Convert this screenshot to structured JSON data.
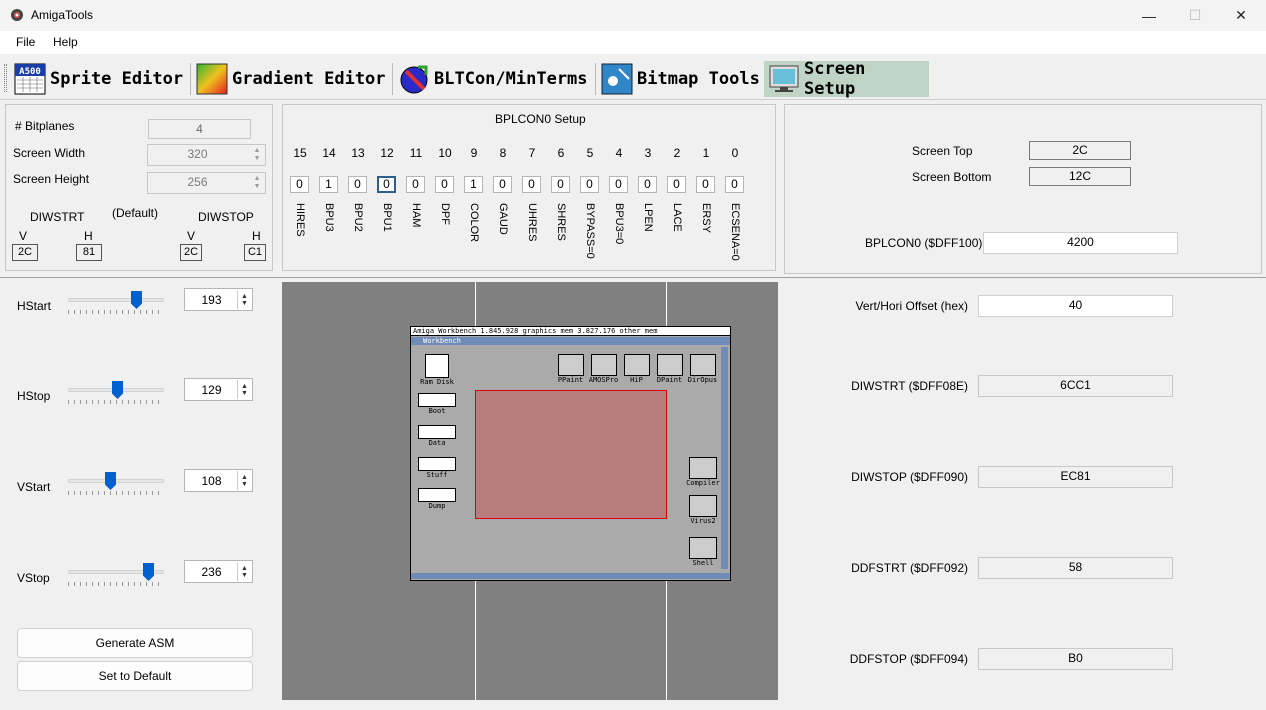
{
  "window": {
    "title": "AmigaTools",
    "minimize": "—",
    "maximize": "☐",
    "close": "✕"
  },
  "menu": [
    "File",
    "Help"
  ],
  "tabs": [
    {
      "label": "Sprite Editor",
      "icon": "sprite-icon"
    },
    {
      "label": "Gradient Editor",
      "icon": "gradient-icon"
    },
    {
      "label": "BLTCon/MinTerms",
      "icon": "blitter-icon"
    },
    {
      "label": "Bitmap Tools",
      "icon": "bitmap-icon"
    },
    {
      "label": "Screen Setup",
      "icon": "monitor-icon",
      "active": true
    }
  ],
  "sprite_icon_text": "A500",
  "screen": {
    "bitplanes_label": "# Bitplanes",
    "bitplanes": "4",
    "width_label": "Screen Width",
    "width": "320",
    "height_label": "Screen Height",
    "height": "256",
    "diwstrt_label": "DIWSTRT",
    "default_label": "(Default)",
    "diwstop_label": "DIWSTOP",
    "v_label": "V",
    "h_label": "H",
    "diwstrt_v": "2C",
    "diwstrt_h": "81",
    "diwstop_v": "2C",
    "diwstop_h": "C1"
  },
  "bplcon0": {
    "title": "BPLCON0 Setup",
    "bits": [
      "15",
      "14",
      "13",
      "12",
      "11",
      "10",
      "9",
      "8",
      "7",
      "6",
      "5",
      "4",
      "3",
      "2",
      "1",
      "0"
    ],
    "values": [
      "0",
      "1",
      "0",
      "0",
      "0",
      "0",
      "1",
      "0",
      "0",
      "0",
      "0",
      "0",
      "0",
      "0",
      "0",
      "0"
    ],
    "names": [
      "HIRES",
      "BPU3",
      "BPU2",
      "BPU1",
      "HAM",
      "DPF",
      "COLOR",
      "GAUD",
      "UHRES",
      "SHRES",
      "BYPASS=0",
      "BPU3=0",
      "LPEN",
      "LACE",
      "ERSY",
      "ECSENA=0"
    ]
  },
  "right_top": {
    "top_label": "Screen Top",
    "top_value": "2C",
    "bottom_label": "Screen Bottom",
    "bottom_value": "12C",
    "bplcon0_label": "BPLCON0 ($DFF100)",
    "bplcon0_value": "4200"
  },
  "sliders": [
    {
      "label": "HStart",
      "value": "193",
      "level": 0.74
    },
    {
      "label": "HStop",
      "value": "129",
      "level": 0.52
    },
    {
      "label": "VStart",
      "value": "108",
      "level": 0.44
    },
    {
      "label": "VStop",
      "value": "236",
      "level": 0.88
    }
  ],
  "buttons": {
    "generate": "Generate ASM",
    "reset": "Set to Default"
  },
  "registers": [
    {
      "label": "Vert/Hori Offset (hex)",
      "value": "40"
    },
    {
      "label": "DIWSTRT ($DFF08E)",
      "value": "6CC1"
    },
    {
      "label": "DIWSTOP ($DFF090)",
      "value": "EC81"
    },
    {
      "label": "DDFSTRT ($DFF092)",
      "value": "58"
    },
    {
      "label": "DDFSTOP ($DFF094)",
      "value": "B0"
    }
  ],
  "workbench": {
    "title": "Amiga Workbench  1.845.928 graphics mem  3.827.176 other mem",
    "window_title": "Workbench",
    "left_icons": [
      "Ram Disk",
      "Boot",
      "Data",
      "Stuff",
      "Dump"
    ],
    "top_icons": [
      "PPaint",
      "AMOSPro",
      "HiP",
      "DPaint",
      "DirOpus"
    ],
    "right_icons": [
      "Compiler",
      "Virus2",
      "Shell"
    ]
  }
}
